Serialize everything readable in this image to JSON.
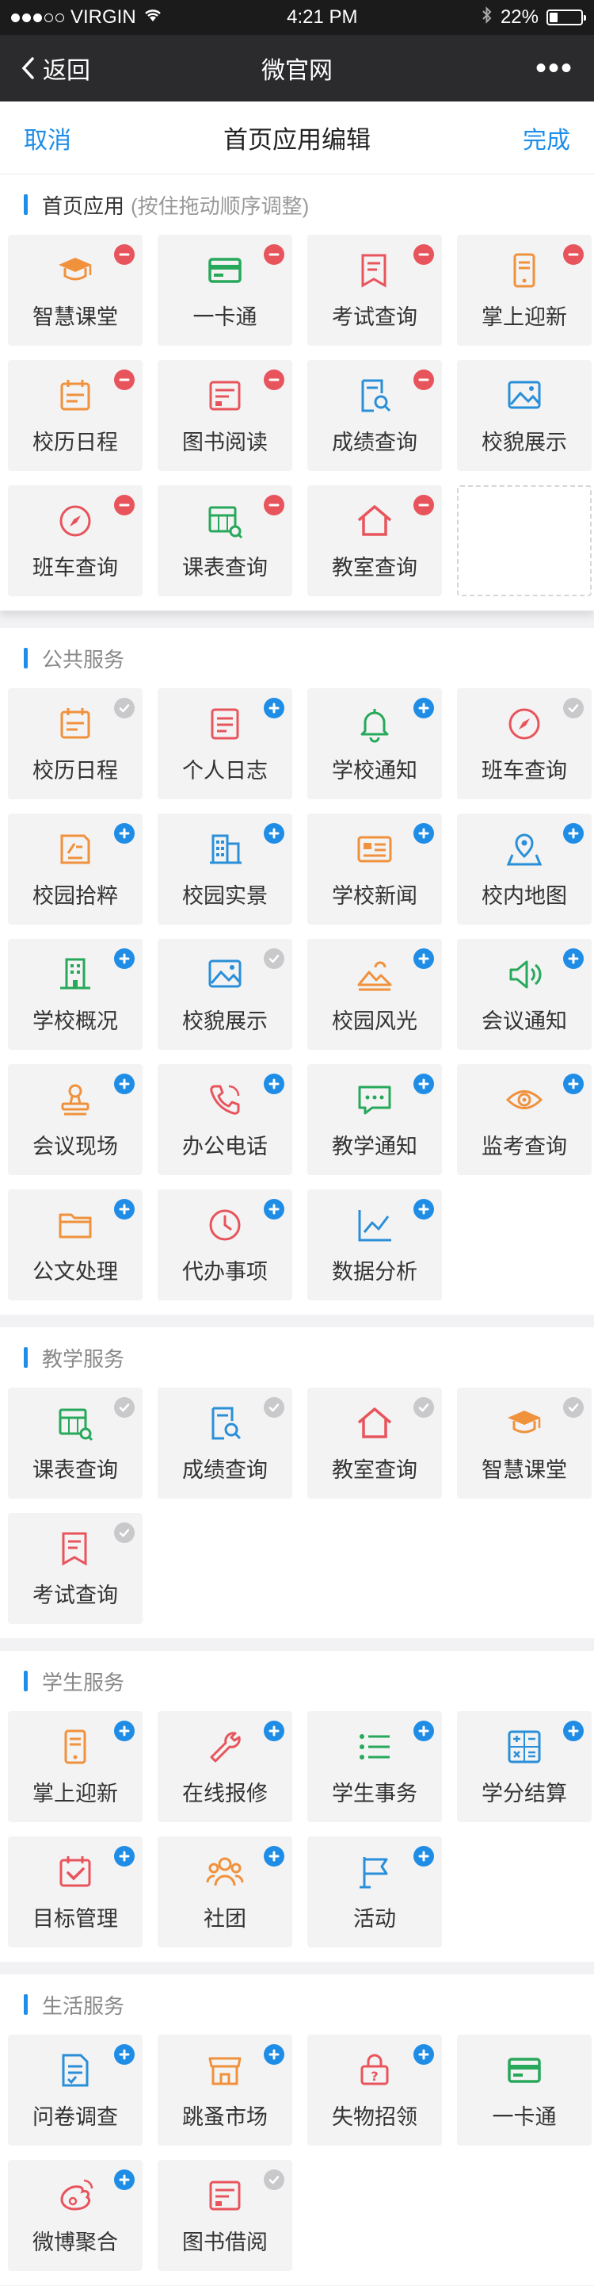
{
  "status": {
    "carrier": "VIRGIN",
    "time": "4:21 PM",
    "battery": "22%"
  },
  "nav": {
    "back": "返回",
    "title": "微官网"
  },
  "editbar": {
    "cancel": "取消",
    "title": "首页应用编辑",
    "done": "完成"
  },
  "sections": [
    {
      "name": "首页应用",
      "hint": "(按住拖动顺序调整)",
      "home": true,
      "placeholder": true,
      "items": [
        {
          "label": "智慧课堂",
          "icon": "mortarboard-icon",
          "color": "#f0913b",
          "state": "remove"
        },
        {
          "label": "一卡通",
          "icon": "card-icon",
          "color": "#27a85a",
          "state": "remove"
        },
        {
          "label": "考试查询",
          "icon": "exam-icon",
          "color": "#e8545c",
          "state": "remove"
        },
        {
          "label": "掌上迎新",
          "icon": "phone-icon",
          "color": "#f0913b",
          "state": "remove"
        },
        {
          "label": "校历日程",
          "icon": "calendar-icon",
          "color": "#f0913b",
          "state": "remove"
        },
        {
          "label": "图书阅读",
          "icon": "book-icon",
          "color": "#e8545c",
          "state": "remove"
        },
        {
          "label": "成绩查询",
          "icon": "search-doc-icon",
          "color": "#2a8fd8",
          "state": "remove"
        },
        {
          "label": "校貌展示",
          "icon": "picture-icon",
          "color": "#2a8fd8",
          "state": "none"
        },
        {
          "label": "班车查询",
          "icon": "compass-icon",
          "color": "#e8545c",
          "state": "remove"
        },
        {
          "label": "课表查询",
          "icon": "timetable-icon",
          "color": "#27a85a",
          "state": "remove"
        },
        {
          "label": "教室查询",
          "icon": "house-icon",
          "color": "#e8545c",
          "state": "remove"
        }
      ]
    },
    {
      "name": "公共服务",
      "items": [
        {
          "label": "校历日程",
          "icon": "calendar-icon",
          "color": "#f0913b",
          "state": "added"
        },
        {
          "label": "个人日志",
          "icon": "journal-icon",
          "color": "#e8545c",
          "state": "add"
        },
        {
          "label": "学校通知",
          "icon": "bell-icon",
          "color": "#27a85a",
          "state": "add"
        },
        {
          "label": "班车查询",
          "icon": "compass-icon",
          "color": "#e8545c",
          "state": "added"
        },
        {
          "label": "校园拾粹",
          "icon": "collection-icon",
          "color": "#f0913b",
          "state": "add"
        },
        {
          "label": "校园实景",
          "icon": "building-icon",
          "color": "#2a8fd8",
          "state": "add"
        },
        {
          "label": "学校新闻",
          "icon": "news-icon",
          "color": "#f0913b",
          "state": "add"
        },
        {
          "label": "校内地图",
          "icon": "map-pin-icon",
          "color": "#2a8fd8",
          "state": "add"
        },
        {
          "label": "学校概况",
          "icon": "school-icon",
          "color": "#27a85a",
          "state": "add"
        },
        {
          "label": "校貌展示",
          "icon": "picture-icon",
          "color": "#2a8fd8",
          "state": "added"
        },
        {
          "label": "校园风光",
          "icon": "landscape-icon",
          "color": "#f0913b",
          "state": "add"
        },
        {
          "label": "会议通知",
          "icon": "speaker-icon",
          "color": "#27a85a",
          "state": "add"
        },
        {
          "label": "会议现场",
          "icon": "stamp-icon",
          "color": "#f0913b",
          "state": "add"
        },
        {
          "label": "办公电话",
          "icon": "telephone-icon",
          "color": "#e8545c",
          "state": "add"
        },
        {
          "label": "教学通知",
          "icon": "chat-icon",
          "color": "#27a85a",
          "state": "add"
        },
        {
          "label": "监考查询",
          "icon": "eye-icon",
          "color": "#f0913b",
          "state": "add"
        },
        {
          "label": "公文处理",
          "icon": "folder-icon",
          "color": "#f0913b",
          "state": "add"
        },
        {
          "label": "代办事项",
          "icon": "clock-icon",
          "color": "#e8545c",
          "state": "add"
        },
        {
          "label": "数据分析",
          "icon": "line-chart-icon",
          "color": "#2a8fd8",
          "state": "add"
        }
      ]
    },
    {
      "name": "教学服务",
      "items": [
        {
          "label": "课表查询",
          "icon": "timetable-icon",
          "color": "#27a85a",
          "state": "added"
        },
        {
          "label": "成绩查询",
          "icon": "search-doc-icon",
          "color": "#2a8fd8",
          "state": "added"
        },
        {
          "label": "教室查询",
          "icon": "house-icon",
          "color": "#e8545c",
          "state": "added"
        },
        {
          "label": "智慧课堂",
          "icon": "mortarboard-icon",
          "color": "#f0913b",
          "state": "added"
        },
        {
          "label": "考试查询",
          "icon": "exam-icon",
          "color": "#e8545c",
          "state": "added"
        }
      ]
    },
    {
      "name": "学生服务",
      "items": [
        {
          "label": "掌上迎新",
          "icon": "phone-icon",
          "color": "#f0913b",
          "state": "add"
        },
        {
          "label": "在线报修",
          "icon": "wrench-icon",
          "color": "#e8545c",
          "state": "add"
        },
        {
          "label": "学生事务",
          "icon": "list-icon",
          "color": "#27a85a",
          "state": "add"
        },
        {
          "label": "学分结算",
          "icon": "calculator-icon",
          "color": "#2a8fd8",
          "state": "add"
        },
        {
          "label": "目标管理",
          "icon": "target-icon",
          "color": "#e8545c",
          "state": "add"
        },
        {
          "label": "社团",
          "icon": "group-icon",
          "color": "#f0913b",
          "state": "add"
        },
        {
          "label": "活动",
          "icon": "flag-icon",
          "color": "#2a8fd8",
          "state": "add"
        }
      ]
    },
    {
      "name": "生活服务",
      "items": [
        {
          "label": "问卷调查",
          "icon": "survey-icon",
          "color": "#2a8fd8",
          "state": "add"
        },
        {
          "label": "跳蚤市场",
          "icon": "shop-icon",
          "color": "#f0913b",
          "state": "add"
        },
        {
          "label": "失物招领",
          "icon": "lost-found-icon",
          "color": "#e8545c",
          "state": "add"
        },
        {
          "label": "一卡通",
          "icon": "card-icon",
          "color": "#27a85a",
          "state": "none"
        },
        {
          "label": "微博聚合",
          "icon": "weibo-icon",
          "color": "#e8545c",
          "state": "add"
        },
        {
          "label": "图书借阅",
          "icon": "book-icon",
          "color": "#e8545c",
          "state": "added"
        }
      ]
    }
  ]
}
